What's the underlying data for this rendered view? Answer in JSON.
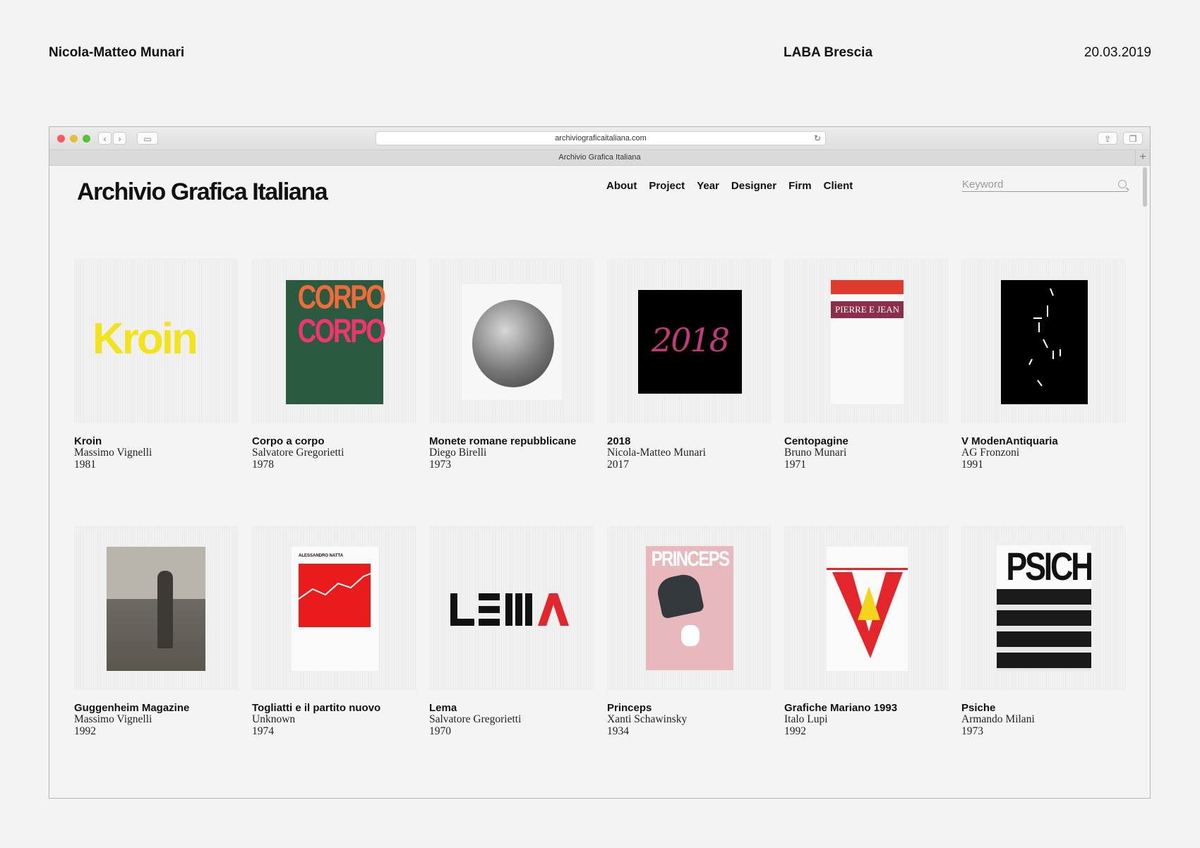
{
  "meta": {
    "author": "Nicola-Matteo Munari",
    "school": "LABA Brescia",
    "date": "20.03.2019"
  },
  "browser": {
    "url": "archiviograficaitaliana.com",
    "tab_title": "Archivio Grafica Italiana"
  },
  "site": {
    "logo": "Archivio Grafica Italiana",
    "nav": [
      "About",
      "Project",
      "Year",
      "Designer",
      "Firm",
      "Client"
    ],
    "search_placeholder": "Keyword"
  },
  "projects": [
    {
      "title": "Kroin",
      "designer": "Massimo Vignelli",
      "year": "1981",
      "art_text": "Kroin"
    },
    {
      "title": "Corpo a corpo",
      "designer": "Salvatore Gregorietti",
      "year": "1978",
      "art_text": "CORPO"
    },
    {
      "title": "Monete romane repubblicane",
      "designer": "Diego Birelli",
      "year": "1973"
    },
    {
      "title": "2018",
      "designer": "Nicola-Matteo Munari",
      "year": "2017",
      "art_text": "2018"
    },
    {
      "title": "Centopagine",
      "designer": "Bruno Munari",
      "year": "1971",
      "art_text": "PIERRE E JEAN"
    },
    {
      "title": "V ModenAntiquaria",
      "designer": "AG Fronzoni",
      "year": "1991"
    },
    {
      "title": "Guggenheim Magazine",
      "designer": "Massimo Vignelli",
      "year": "1992"
    },
    {
      "title": "Togliatti e il partito nuovo",
      "designer": "Unknown",
      "year": "1974",
      "art_text": "ALESSANDRO NATTA"
    },
    {
      "title": "Lema",
      "designer": "Salvatore Gregorietti",
      "year": "1970"
    },
    {
      "title": "Princeps",
      "designer": "Xanti Schawinsky",
      "year": "1934",
      "art_text": "PRINCEPS"
    },
    {
      "title": "Grafiche Mariano 1993",
      "designer": "Italo Lupi",
      "year": "1992"
    },
    {
      "title": "Psiche",
      "designer": "Armando Milani",
      "year": "1973",
      "art_text": "PSICHE"
    }
  ]
}
